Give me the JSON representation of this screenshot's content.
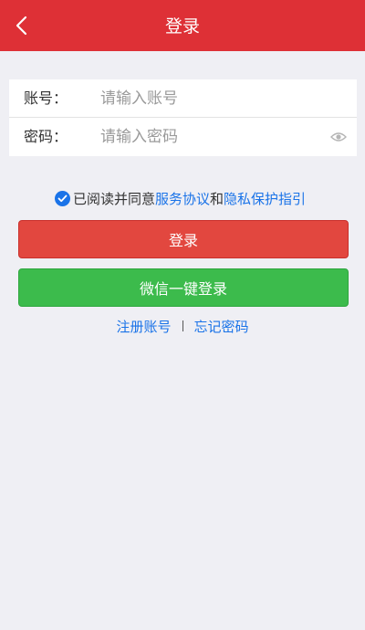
{
  "header": {
    "title": "登录",
    "back_icon": "chevron-left-icon"
  },
  "form": {
    "account": {
      "label": "账号：",
      "placeholder": "请输入账号",
      "value": ""
    },
    "password": {
      "label": "密码：",
      "placeholder": "请输入密码",
      "value": "",
      "visibility_icon": "eye-icon"
    }
  },
  "agreement": {
    "checked": true,
    "prefix": "已阅读并同意",
    "service_link": "服务协议",
    "connector": "和",
    "privacy_link": "隐私保护指引"
  },
  "buttons": {
    "login": "登录",
    "wechat_login": "微信一键登录"
  },
  "links": {
    "register": "注册账号",
    "forgot_password": "忘记密码"
  },
  "colors": {
    "header": "#de3036",
    "login_button": "#e2473f",
    "wechat_button": "#3cbb4c",
    "link": "#1a73e8",
    "background": "#efeff4"
  }
}
